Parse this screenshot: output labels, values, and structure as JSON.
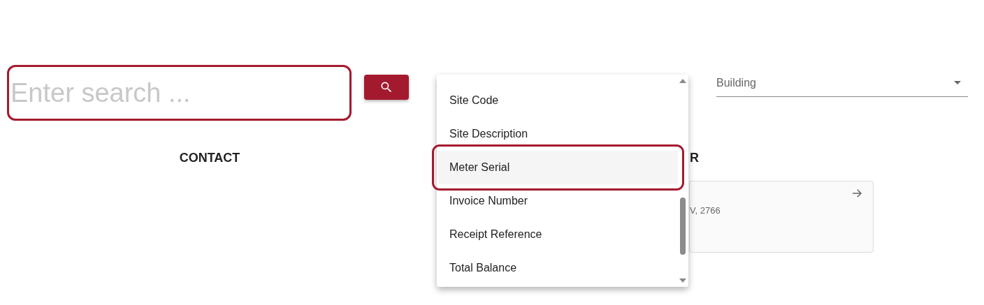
{
  "search": {
    "placeholder": "Enter search ..."
  },
  "filter_select": {
    "value": "Building"
  },
  "sections": [
    {
      "heading": "CONTACT"
    },
    {
      "heading": "R"
    }
  ],
  "card": {
    "text": "V, 2766"
  },
  "dropdown_menu": {
    "items": [
      {
        "label": "Site Code",
        "selected": false
      },
      {
        "label": "Site Description",
        "selected": false
      },
      {
        "label": "Meter Serial",
        "selected": true
      },
      {
        "label": "Invoice Number",
        "selected": false
      },
      {
        "label": "Receipt Reference",
        "selected": false
      },
      {
        "label": "Total Balance",
        "selected": false
      }
    ]
  }
}
